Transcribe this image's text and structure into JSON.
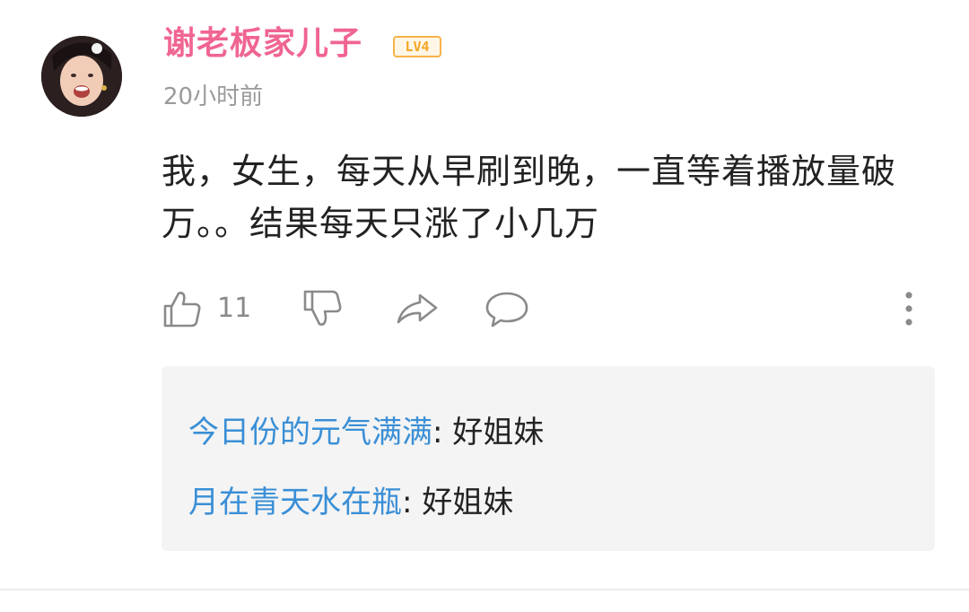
{
  "comment": {
    "username": "谢老板家儿子",
    "level_badge": "LV4",
    "timestamp": "20小时前",
    "body": "我，女生，每天从早刷到晚，一直等着播放量破万。。结果每天只涨了小几万",
    "actions": {
      "like_icon": "thumbs-up-icon",
      "like_count": "11",
      "dislike_icon": "thumbs-down-icon",
      "share_icon": "share-arrow-icon",
      "reply_icon": "speech-bubble-icon",
      "more_icon": "vertical-dots-icon"
    }
  },
  "replies": [
    {
      "author": "今日份的元气满满",
      "separator": ": ",
      "text": "好姐妹"
    },
    {
      "author": "月在青天水在瓶",
      "separator": ": ",
      "text": "好姐妹"
    }
  ],
  "colors": {
    "username": "#f06592",
    "reply_author": "#3a8fd6",
    "badge": "#f5a623",
    "timestamp": "#9a9a9a",
    "icon": "#8a8a8a"
  }
}
